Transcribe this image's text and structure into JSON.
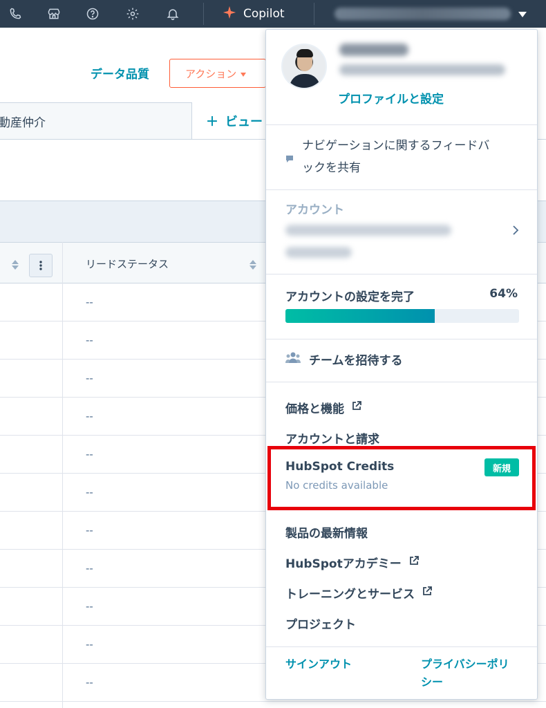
{
  "topbar": {
    "icons": [
      "phone-icon",
      "marketplace-icon",
      "help-icon",
      "settings-icon",
      "notifications-icon"
    ],
    "copilot_label": "Copilot"
  },
  "page": {
    "data_quality": "データ品質",
    "actions_button": "アクション",
    "current_tab": "動産仲介",
    "add_view": "ビュー",
    "column_header": "リードステータス",
    "empty_cell": "--"
  },
  "dropdown": {
    "profile_link": "プロファイルと設定",
    "feedback_line1": "ナビゲーションに関するフィードバ",
    "feedback_line2": "ックを共有",
    "account_label": "アカウント",
    "setup_title": "アカウントの設定を完了",
    "setup_percent": "64%",
    "setup_progress": 0.64,
    "invite_team": "チームを招待する",
    "pricing": "価格と機能",
    "account_billing": "アカウントと請求",
    "credits_title": "HubSpot Credits",
    "credits_subtitle": "No credits available",
    "credits_badge": "新規",
    "product_updates": "製品の最新情報",
    "academy": "HubSpotアカデミー",
    "training": "トレーニングとサービス",
    "projects": "プロジェクト",
    "sign_out": "サインアウト",
    "privacy_line1": "プライバシーポリ",
    "privacy_line2": "シー"
  },
  "colors": {
    "topbar": "#2d3e50",
    "link": "#0091ae",
    "accent_orange": "#ff7a59",
    "highlight": "#e8000b",
    "badge": "#00bda5"
  }
}
